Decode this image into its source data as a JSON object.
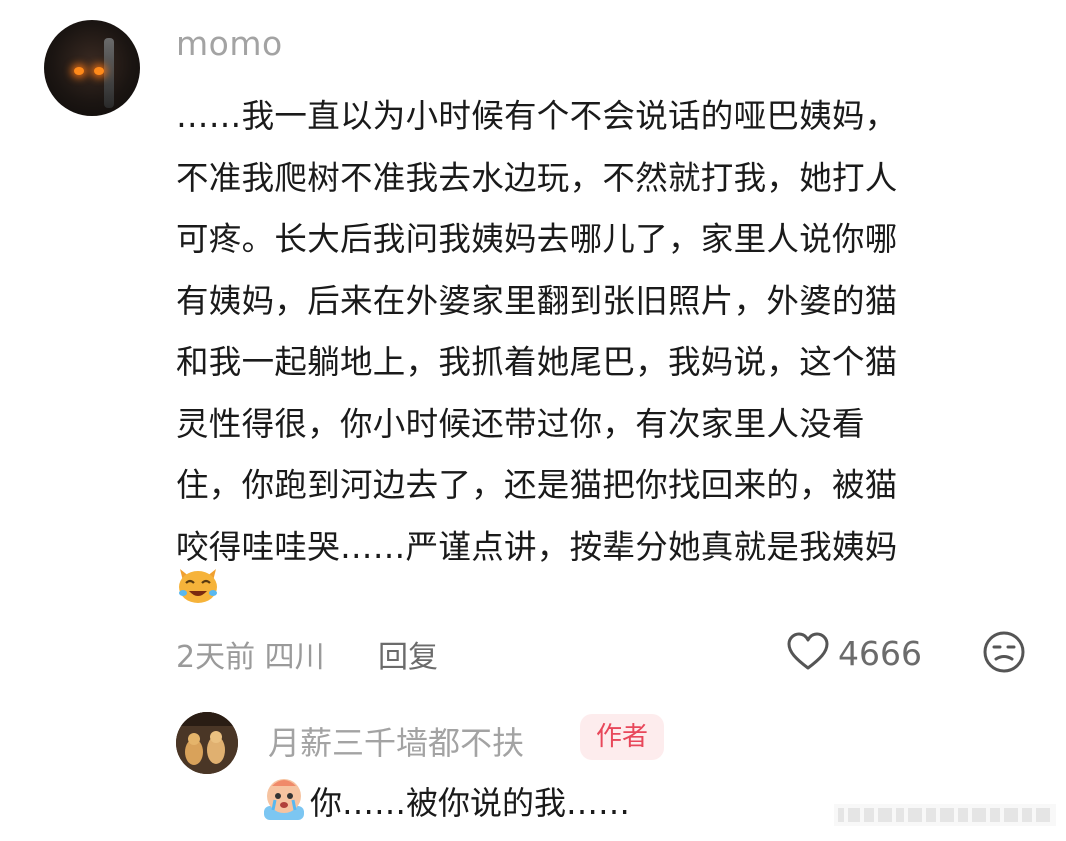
{
  "comment": {
    "username": "momo",
    "lines": [
      "……我一直以为小时候有个不会说话的哑巴姨妈，",
      "不准我爬树不准我去水边玩，不然就打我，她打人",
      "可疼。长大后我问我姨妈去哪儿了，家里人说你哪",
      "有姨妈，后来在外婆家里翻到张旧照片，外婆的猫",
      "和我一起躺地上，我抓着她尾巴，我妈说，这个猫",
      "灵性得很，你小时候还带过你，有次家里人没看",
      "住，你跑到河边去了，还是猫把你找回来的，被猫",
      "咬得哇哇哭……严谨点讲，按辈分她真就是我姨妈"
    ],
    "emoji_icon": "laughing-crying-cat-icon",
    "meta_text": "2天前 四川",
    "reply_label": "回复",
    "like_count": "4666"
  },
  "reply": {
    "username": "月薪三千墙都不扶",
    "author_badge": "作者",
    "emoji_icon": "crying-face-icon",
    "text": "你……被你说的我……"
  },
  "colors": {
    "badge_bg": "#fdeced",
    "badge_text": "#e8475a",
    "muted_text": "#a3a3a3",
    "body_text": "#1a1a1a"
  }
}
